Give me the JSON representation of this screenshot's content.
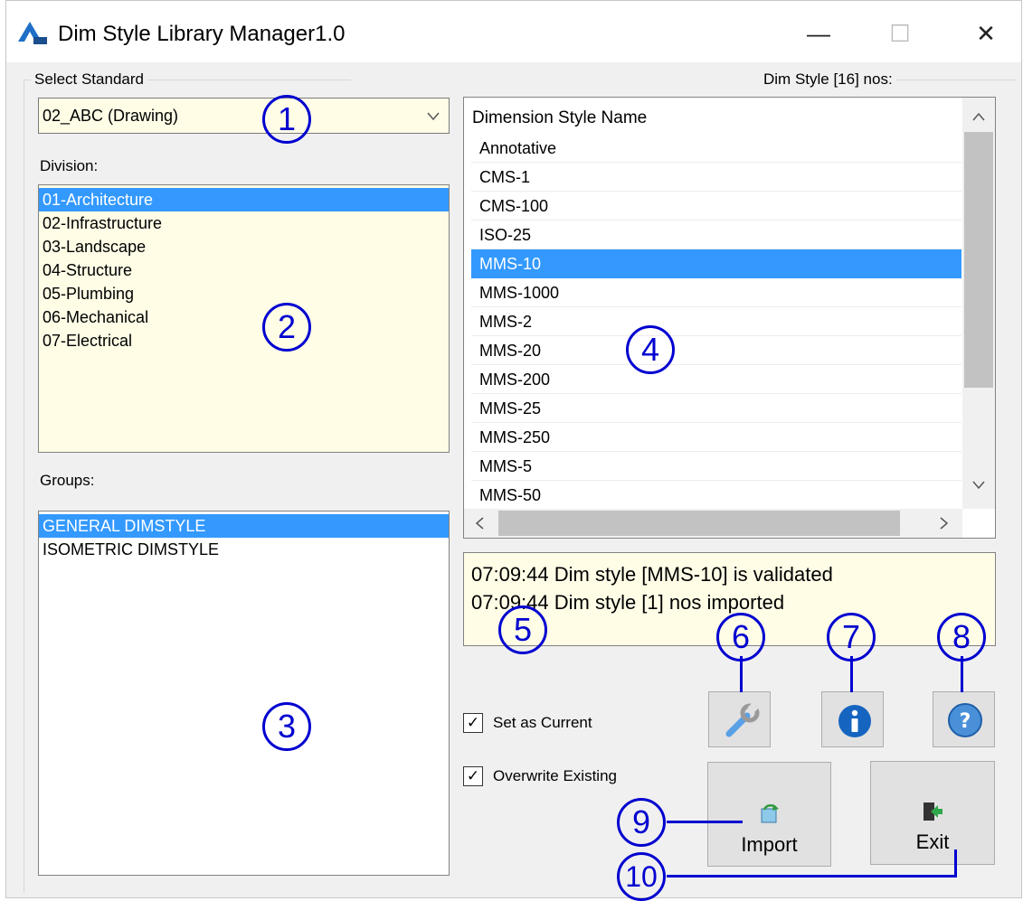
{
  "window": {
    "title": "Dim Style Library Manager1.0",
    "controls": {
      "minimize": "—",
      "maximize": "☐",
      "close": "✕"
    }
  },
  "select_standard": {
    "label": "Select Standard",
    "selected": "02_ABC (Drawing)"
  },
  "division": {
    "label": "Division:",
    "items": [
      "01-Architecture",
      "02-Infrastructure",
      "03-Landscape",
      "04-Structure",
      "05-Plumbing",
      "06-Mechanical",
      "07-Electrical"
    ],
    "selected_index": 0
  },
  "groups": {
    "label": "Groups:",
    "items": [
      "GENERAL DIMSTYLE",
      "ISOMETRIC DIMSTYLE"
    ],
    "selected_index": 0
  },
  "dim_style": {
    "label": "Dim Style [16] nos:",
    "column_header": "Dimension Style Name",
    "rows": [
      "Annotative",
      "CMS-1",
      "CMS-100",
      "ISO-25",
      "MMS-10",
      "MMS-1000",
      "MMS-2",
      "MMS-20",
      "MMS-200",
      "MMS-25",
      "MMS-250",
      "MMS-5",
      "MMS-50"
    ],
    "selected_index": 4
  },
  "log": {
    "lines": [
      "07:09:44 Dim style [MMS-10] is validated",
      "07:09:44 Dim style [1] nos imported"
    ]
  },
  "options": {
    "set_current": "Set as Current",
    "overwrite": "Overwrite Existing",
    "check_mark": "✓"
  },
  "buttons": {
    "import": "Import",
    "exit": "Exit"
  },
  "callouts": [
    "1",
    "2",
    "3",
    "4",
    "5",
    "6",
    "7",
    "8",
    "9",
    "10"
  ],
  "colors": {
    "selection": "#3399ff",
    "callout": "#0000d0",
    "list_background": "#fffde6"
  },
  "icons": [
    "app-logo-icon",
    "chevron-down-icon",
    "wrench-icon",
    "info-icon",
    "help-icon",
    "import-icon",
    "exit-icon"
  ]
}
